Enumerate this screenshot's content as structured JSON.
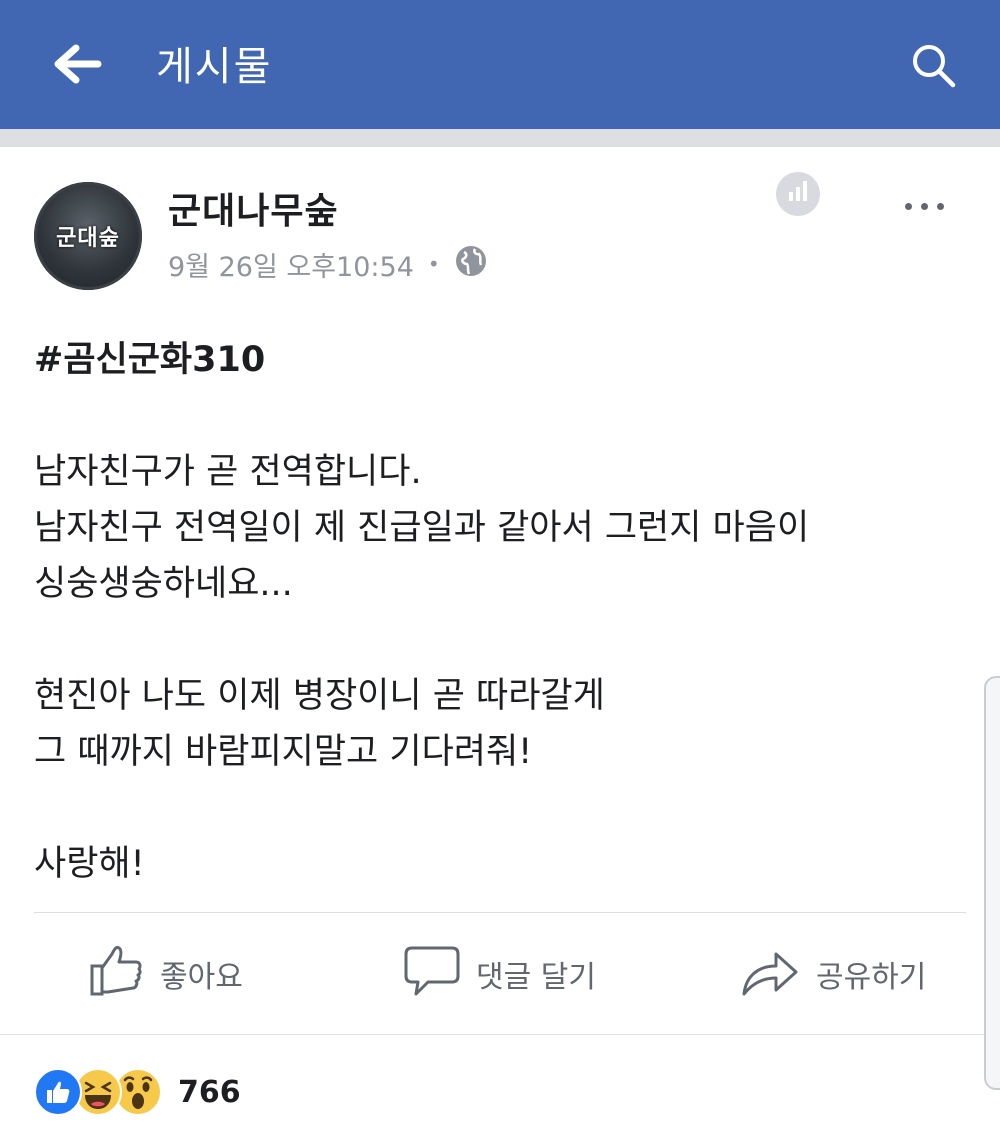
{
  "header": {
    "title": "게시물",
    "back_icon": "arrow-left-icon",
    "search_icon": "search-icon",
    "background_color": "#4267b2"
  },
  "post": {
    "author": "군대나무숲",
    "avatar_text": "군대숲",
    "timestamp": "9월 26일 오후10:54",
    "separator": "•",
    "privacy_icon": "globe-icon",
    "insights_icon": "bar-chart-icon",
    "more_icon": "more-horizontal-icon",
    "hashtag": "#곰신군화310",
    "lines": [
      "남자친구가 곧 전역합니다.",
      "남자친구 전역일이 제 진급일과 같아서 그런지 마음이",
      "싱숭생숭하네요...",
      "현진아 나도 이제 병장이니 곧 따라갈게",
      "그 때까지 바람피지말고 기다려줘!",
      "사랑해!"
    ]
  },
  "actions": {
    "like_label": "좋아요",
    "comment_label": "댓글 달기",
    "share_label": "공유하기"
  },
  "reactions": {
    "icons": [
      "like-reaction-icon",
      "haha-reaction-icon",
      "wow-reaction-icon"
    ],
    "count": "766",
    "like_color": "#2078f4",
    "emoji_color": "#f7c94a"
  }
}
